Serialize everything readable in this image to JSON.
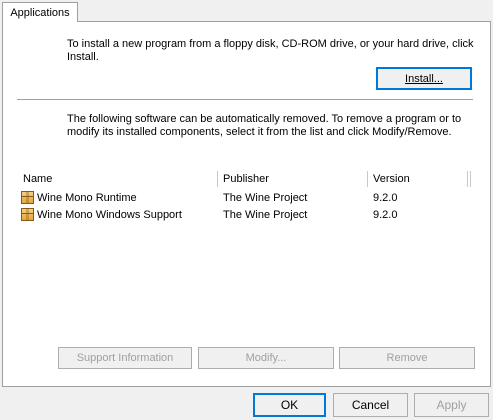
{
  "tabs": [
    {
      "label": "Applications",
      "active": true
    }
  ],
  "install": {
    "intro_text": "To install a new program from a floppy disk, CD-ROM drive, or your hard drive, click Install.",
    "button_label": "Install..."
  },
  "remove": {
    "text": "The following software can be automatically removed. To remove a program or to modify its installed components, select it from the list and click Modify/Remove."
  },
  "list": {
    "columns": [
      "Name",
      "Publisher",
      "Version"
    ],
    "rows": [
      {
        "name": "Wine Mono Runtime",
        "publisher": "The Wine Project",
        "version": "9.2.0",
        "icon": "package-icon"
      },
      {
        "name": "Wine Mono Windows Support",
        "publisher": "The Wine Project",
        "version": "9.2.0",
        "icon": "package-icon"
      }
    ]
  },
  "actions": {
    "support_info": "Support Information",
    "modify": "Modify...",
    "remove": "Remove"
  },
  "dialog": {
    "ok": "OK",
    "cancel": "Cancel",
    "apply": "Apply"
  },
  "colors": {
    "focus": "#0078d7",
    "disabled_text": "#a0a0a0",
    "background": "#f0f0f0"
  }
}
